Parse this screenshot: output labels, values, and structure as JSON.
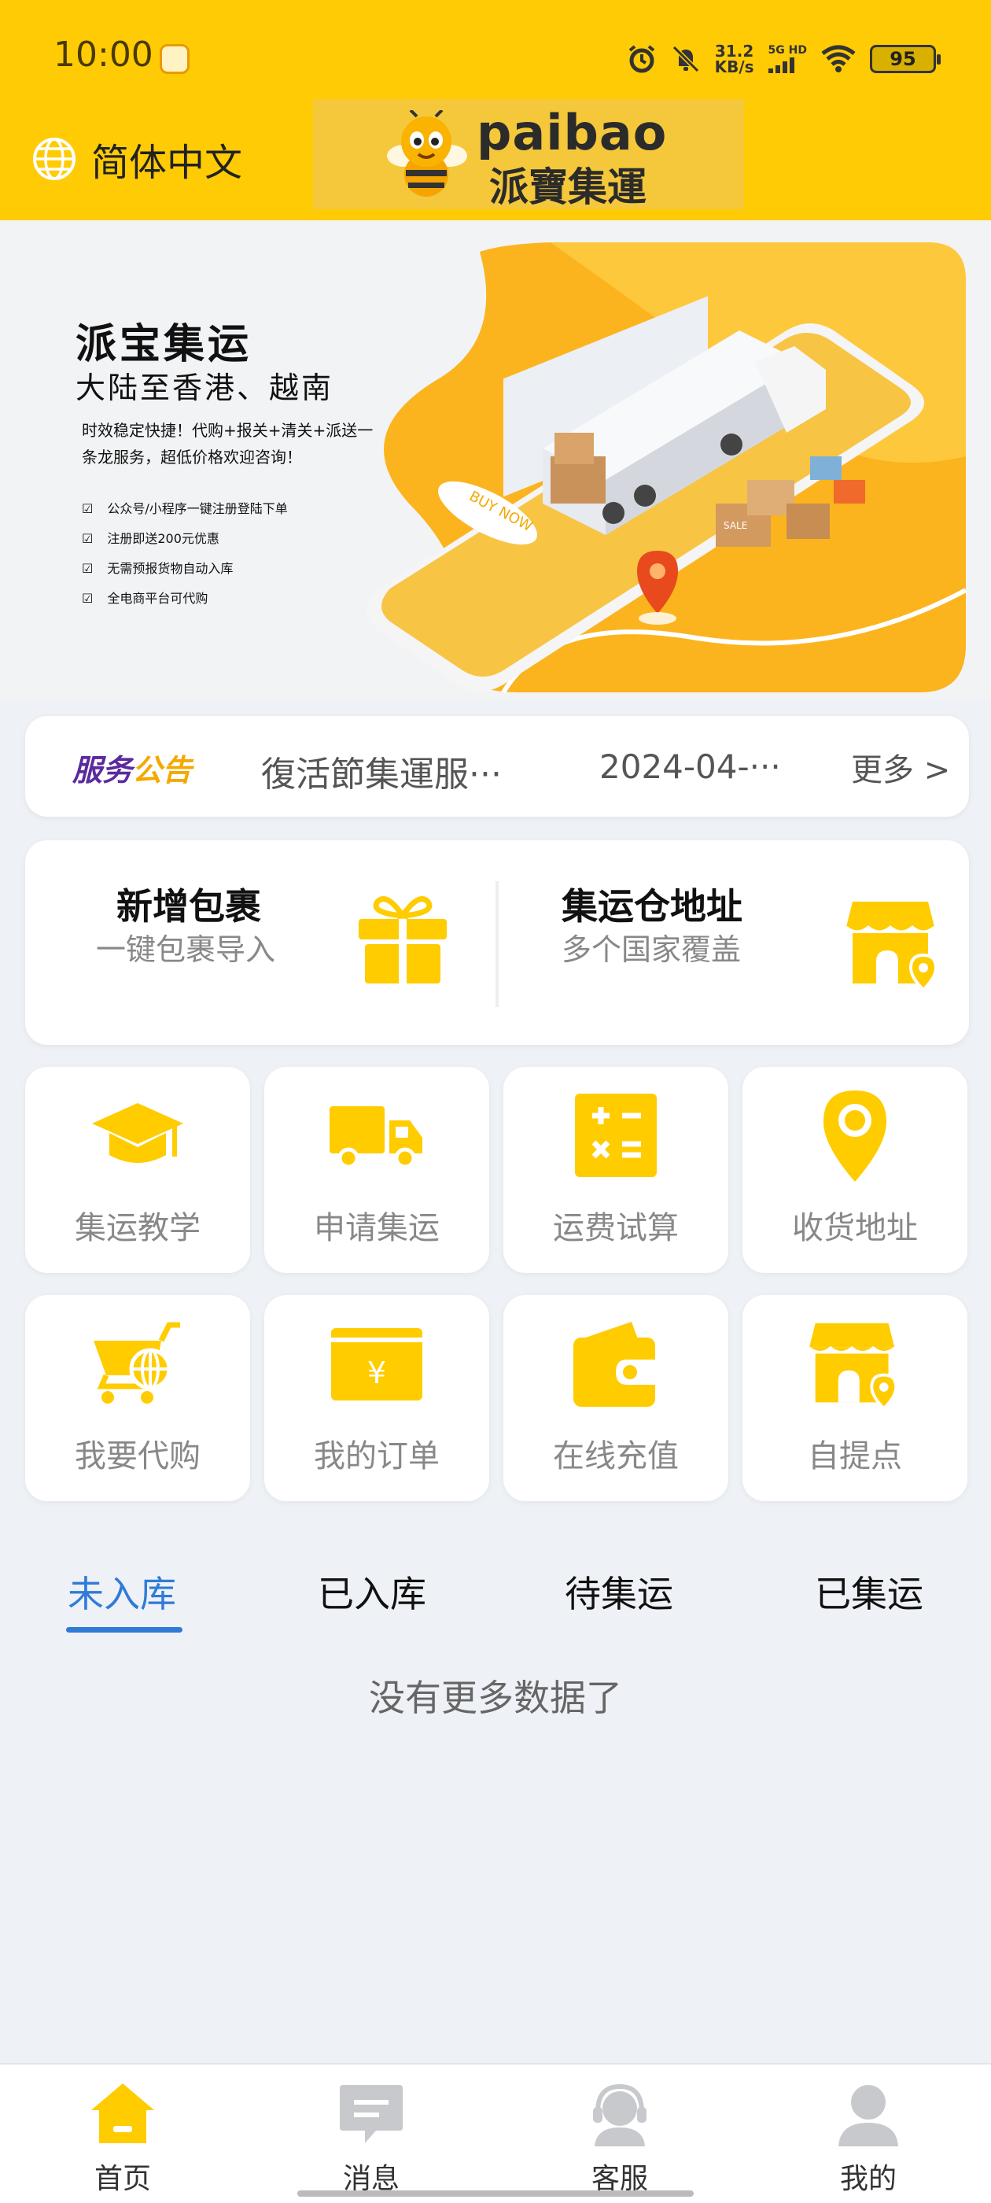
{
  "status_bar": {
    "time": "10:00",
    "net_speed_value": "31.2",
    "net_speed_unit": "KB/s",
    "signal_label": "5G HD",
    "battery": "95"
  },
  "header": {
    "language": "简体中文",
    "logo_en": "paibao",
    "logo_cn": "派寶集運"
  },
  "banner": {
    "title": "派宝集运",
    "subtitle": "大陆至香港、越南",
    "description": "时效稳定快捷！代购+报关+清关+派送一条龙服务，超低价格欢迎咨询！",
    "features": [
      "公众号/小程序一键注册登陆下单",
      "注册即送200元优惠",
      "无需预报货物自动入库",
      "全电商平台可代购"
    ],
    "sign_text": "BUY NOW",
    "box_text": "SALE"
  },
  "notice": {
    "tag_part1": "服务",
    "tag_part2": "公告",
    "text": "復活節集運服···",
    "date": "2024-04-···",
    "more": "更多 >"
  },
  "quick_actions": [
    {
      "title": "新增包裹",
      "subtitle": "一键包裹导入",
      "icon": "gift-icon"
    },
    {
      "title": "集运仓地址",
      "subtitle": "多个国家覆盖",
      "icon": "store-location-icon"
    }
  ],
  "grid": [
    {
      "label": "集运教学",
      "icon": "graduation-cap-icon"
    },
    {
      "label": "申请集运",
      "icon": "truck-icon"
    },
    {
      "label": "运费试算",
      "icon": "calculator-icon"
    },
    {
      "label": "收货地址",
      "icon": "location-pin-icon"
    },
    {
      "label": "我要代购",
      "icon": "shopping-cart-icon"
    },
    {
      "label": "我的订单",
      "icon": "order-yen-icon"
    },
    {
      "label": "在线充值",
      "icon": "wallet-icon"
    },
    {
      "label": "自提点",
      "icon": "store-location-icon"
    }
  ],
  "tabs": [
    "未入库",
    "已入库",
    "待集运",
    "已集运"
  ],
  "active_tab": "未入库",
  "empty_text": "没有更多数据了",
  "bottom_nav": [
    {
      "label": "首页",
      "icon": "home-icon",
      "active": true
    },
    {
      "label": "消息",
      "icon": "message-icon",
      "active": false
    },
    {
      "label": "客服",
      "icon": "customer-service-icon",
      "active": false
    },
    {
      "label": "我的",
      "icon": "profile-icon",
      "active": false
    }
  ],
  "colors": {
    "brand_yellow": "#ffcb05",
    "icon_yellow": "#ffcc00",
    "active_blue": "#2f7bd8",
    "notice_purple": "#5b2a9e",
    "notice_orange": "#f5a800"
  }
}
